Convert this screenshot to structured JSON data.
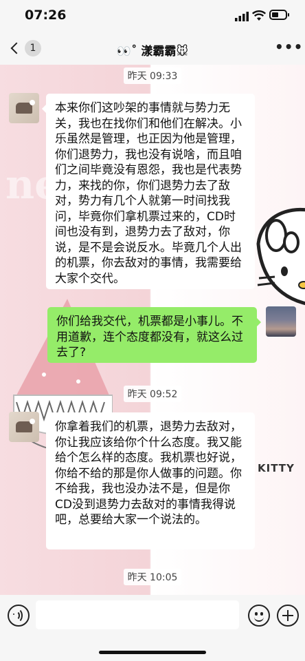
{
  "status_bar": {
    "time": "07:26"
  },
  "header": {
    "title": "👀˚ 漾霸霸🐭",
    "unread_count": "1"
  },
  "background": {
    "watermark_word": "ne",
    "kitty_word": "KITTY"
  },
  "messages": [
    {
      "type": "timestamp",
      "text": "昨天 09:33"
    },
    {
      "type": "incoming",
      "text": "本来你们这吵架的事情就与势力无关，我也在找你们和他们在解决。小乐虽然是管理，也正因为他是管理，你们退势力，我也没有说啥，而且咱们之间毕竟没有恩怨，我也是代表势力，来找的你，你们退势力去了敌对，势力有几个人就第一时间找我问，毕竟你们拿机票过来的，CD时间也没有到，退势力去了敌对，你说，是不是会说反水。毕竟几个人出的机票，你去敌对的事情，我需要给大家个交代。"
    },
    {
      "type": "outgoing",
      "text": "你们给我交代，机票都是小事儿。不用道歉，连个态度都没有，就这么过去了?"
    },
    {
      "type": "timestamp",
      "text": "昨天 09:52"
    },
    {
      "type": "incoming",
      "text": "你拿着我们的机票，退势力去敌对，你让我应该给你个什么态度。我又能给个怎么样的态度。我机票也好说，你给不给的那是你人做事的问题。你不给我，我也没办法不是，但是你CD没到退势力去敌对的事情我得说吧，总要给大家一个说法的。"
    },
    {
      "type": "timestamp",
      "text": "昨天 10:05"
    }
  ],
  "input_bar": {
    "placeholder": ""
  },
  "colors": {
    "outgoing_bubble": "#95ec69",
    "incoming_bubble": "#ffffff",
    "bar_bg": "#f6f6f6"
  }
}
